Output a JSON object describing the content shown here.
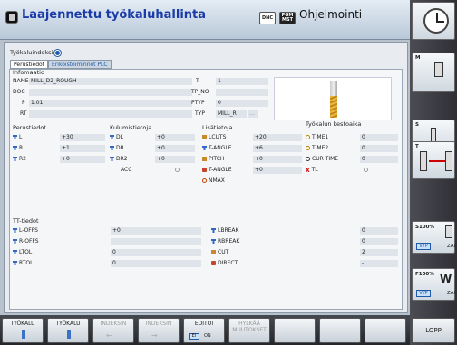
{
  "app": {
    "title": "Laajennettu työkaluhallinta",
    "dnc": "DNC",
    "pgm": "PGM MST",
    "mode": "Ohjelmointi"
  },
  "breadcrumb": "Työkaluindeksi",
  "tabs": [
    "Perustiedot",
    "Erikoistoiminnot PLC"
  ],
  "info": {
    "title": "Infomaatio",
    "name_label": "NAME",
    "name_value": "MILL_D2_ROUGH",
    "doc_label": "DOC",
    "doc_value": "",
    "p_label": "P",
    "p_value": "1.01",
    "rt_label": "RT",
    "rt_value": "",
    "t_label": "T",
    "t_value": "1",
    "tpno_label": "TP_NO",
    "tpno_value": "",
    "ptyp_label": "PTYP",
    "ptyp_value": "0",
    "typ_label": "TYP",
    "typ_value": "MILL_R"
  },
  "perus": {
    "title": "Perustiedot",
    "rows": [
      {
        "label": "L",
        "value": "+30"
      },
      {
        "label": "R",
        "value": "+1"
      },
      {
        "label": "R2",
        "value": "+0"
      }
    ]
  },
  "kulum": {
    "title": "Kulumistietoja",
    "rows": [
      {
        "label": "DL",
        "value": "+0"
      },
      {
        "label": "DR",
        "value": "+0"
      },
      {
        "label": "DR2",
        "value": "+0"
      }
    ],
    "acc_label": "ACC"
  },
  "lisa": {
    "title": "Lisätietoja",
    "rows": [
      {
        "label": "LCUTS",
        "value": "+20"
      },
      {
        "label": "T-ANGLE",
        "value": "+6"
      },
      {
        "label": "PITCH",
        "value": "+0"
      },
      {
        "label": "T-ANGLE",
        "value": "+0"
      },
      {
        "label": "NMAX",
        "value": ""
      }
    ]
  },
  "kesto": {
    "title": "Työkalun kestoaika",
    "rows": [
      {
        "label": "TIME1",
        "value": "0"
      },
      {
        "label": "TIME2",
        "value": "0"
      },
      {
        "label": "CUR TIME",
        "value": "0"
      },
      {
        "label": "TL",
        "value": ""
      }
    ]
  },
  "tt": {
    "title": "TT-tiedot",
    "left": [
      {
        "label": "L-OFFS",
        "value": "+0"
      },
      {
        "label": "R-OFFS",
        "value": ""
      },
      {
        "label": "LTOL",
        "value": "0"
      },
      {
        "label": "RTOL",
        "value": "0"
      }
    ],
    "right": [
      {
        "label": "LBREAK",
        "value": "0"
      },
      {
        "label": "RBREAK",
        "value": "0"
      },
      {
        "label": "CUT",
        "value": "2"
      },
      {
        "label": "DIRECT",
        "value": "-"
      }
    ]
  },
  "sidebar": {
    "m_label": "M",
    "s_label": "S",
    "t_label": "T",
    "s_override": "S100%",
    "f_override": "F100%",
    "vyp": "VYP",
    "zar": "ZAI"
  },
  "softkeys": {
    "k1": "TYÖKALU",
    "k2": "TYÖKALU",
    "k3": "INDEKSIN",
    "k4": "INDEKSIN",
    "k5": "EDITOI",
    "k5_off": "EI",
    "k5_on": "ON",
    "k6a": "HYLKÄÄ",
    "k6b": "MUUTOKSET",
    "lopp": "LOPP"
  },
  "colors": {
    "accent": "#1e5aa8",
    "title": "#1b3ca8",
    "chrome": "#2f2f35"
  }
}
